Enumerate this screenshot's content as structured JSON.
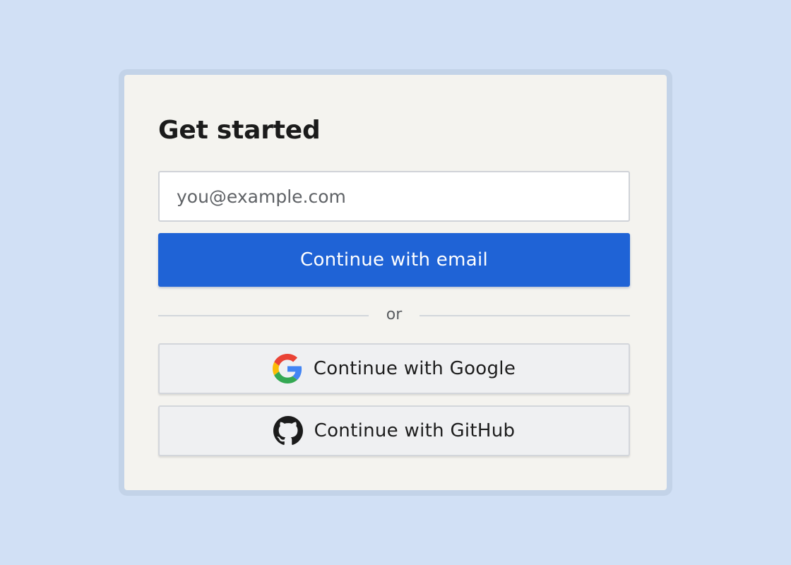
{
  "card": {
    "title": "Get started",
    "email": {
      "value": "",
      "placeholder": "you@example.com"
    },
    "primary_button_label": "Continue with email",
    "divider_text": "or",
    "providers": [
      {
        "name": "google",
        "label": "Continue with Google",
        "icon": "google-icon"
      },
      {
        "name": "github",
        "label": "Continue with GitHub",
        "icon": "github-icon"
      }
    ]
  },
  "colors": {
    "page_background": "#d1e0f5",
    "card_background": "#f4f3ef",
    "card_border": "#c3d3e8",
    "primary": "#1f63d6",
    "secondary_button": "#eff0f2"
  }
}
